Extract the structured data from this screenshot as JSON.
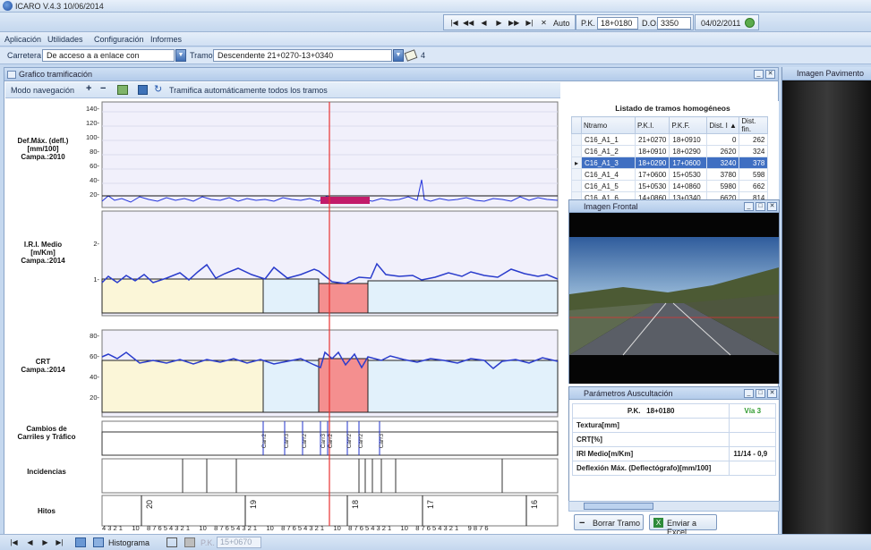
{
  "app": {
    "title": "ICARO V.4.3 10/06/2014"
  },
  "nav": {
    "buttons": [
      "|◀",
      "◀◀",
      "◀",
      "▶",
      "▶▶",
      "▶|",
      "✕"
    ],
    "auto_label": "Auto",
    "pk_label": "P.K.",
    "pk_value": "18+0180",
    "do_label": "D.O.",
    "do_value": "3350",
    "date": "04/02/2011"
  },
  "menu": [
    "Aplicación",
    "Utilidades",
    "Configuración",
    "Informes"
  ],
  "road": {
    "carretera_label": "Carretera",
    "carretera_value": "De acceso a        a enlace con",
    "tramo_label": "Tramo",
    "tramo_value": "Descendente 21+0270-13+0340",
    "count": "4"
  },
  "main_panel": {
    "title": "Grafico tramificación",
    "toolbar": {
      "mode_label": "Modo navegación",
      "plus": "+",
      "minus": "−",
      "auto_label": "Tramifica automáticamente todos los tramos"
    }
  },
  "charts": {
    "deflection": {
      "label_lines": [
        "Def.Máx. (defl.)",
        "[mm/100]",
        "Campa.:2010"
      ],
      "ticks": [
        "140-",
        "120-",
        "100-",
        "80-",
        "60-",
        "40-",
        "20-"
      ]
    },
    "iri": {
      "label_lines": [
        "I.R.I. Medio",
        "[m/Km]",
        "Campa.:2014"
      ],
      "ticks": [
        "2-",
        "1-"
      ]
    },
    "crt": {
      "label_lines": [
        "CRT",
        "Campa.:2014"
      ],
      "ticks": [
        "80-",
        "60-",
        "40-",
        "20-"
      ]
    },
    "lanes": {
      "label_lines": [
        "Cambios de",
        "Carriles y Tráfico"
      ],
      "tags": [
        "Carr2",
        "Carr3",
        "Carr2",
        "Carr3",
        "Carr2",
        "Carr2",
        "Carr2",
        "Carr3"
      ]
    },
    "incidencias": {
      "label": "Incidencias"
    },
    "hitos": {
      "label": "Hitos",
      "markers": [
        "20",
        "19",
        "18",
        "17",
        "16"
      ]
    },
    "axis_ticks": "4 3 2 1     10    8 7 6 5 4 3 2 1     10    8 7 6 5 4 3 2 1     10    8 7 6 5 4 3 2 1     10    8 7 6 5 4 3 2 1     10    8 7 6 5 4 3 2 1     9 8 7 6"
  },
  "list": {
    "title": "Listado de tramos homogéneos",
    "columns": [
      "Ntramo",
      "P.K.I.",
      "P.K.F.",
      "Dist. I ▲",
      "Dist. fin."
    ],
    "rows": [
      [
        "C16_A1_1",
        "21+0270",
        "18+0910",
        "0",
        "262"
      ],
      [
        "C16_A1_2",
        "18+0910",
        "18+0290",
        "2620",
        "324"
      ],
      [
        "C16_A1_3",
        "18+0290",
        "17+0600",
        "3240",
        "378"
      ],
      [
        "C16_A1_4",
        "17+0600",
        "15+0530",
        "3780",
        "598"
      ],
      [
        "C16_A1_5",
        "15+0530",
        "14+0860",
        "5980",
        "662"
      ],
      [
        "C16_A1_6",
        "14+0860",
        "13+0340",
        "6620",
        "814"
      ]
    ],
    "selected_row": 2
  },
  "camera": {
    "title": "Imagen Frontal"
  },
  "params": {
    "title": "Parámetros Auscultación",
    "pk_label": "P.K.",
    "pk_value": "18+0180",
    "via": "Vía 3",
    "rows": [
      [
        "Textura[mm]",
        ""
      ],
      [
        "CRT[%]",
        ""
      ],
      [
        "IRI Medio[m/Km]",
        "11/14 - 0,9"
      ],
      [
        "Deflexión Máx. (Deflectógrafo)[mm/100]",
        ""
      ]
    ],
    "borrar": "Borrar Tramo",
    "excel": "Enviar a Excel"
  },
  "pavement": {
    "title": "Imagen Pavimento"
  },
  "bottom": {
    "histograma": "Histograma",
    "pk_label": "P.K.",
    "pk_value": "15+0670"
  }
}
